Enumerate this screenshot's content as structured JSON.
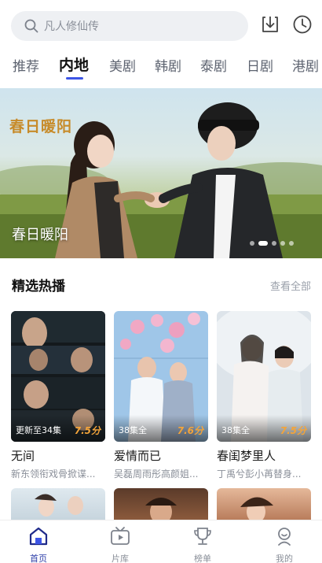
{
  "search": {
    "placeholder": "凡人修仙传"
  },
  "header_icons": {
    "download": "download-icon",
    "history": "clock-icon"
  },
  "tabs": [
    {
      "label": "推荐",
      "active": false
    },
    {
      "label": "内地",
      "active": true
    },
    {
      "label": "美剧",
      "active": false
    },
    {
      "label": "韩剧",
      "active": false
    },
    {
      "label": "泰剧",
      "active": false
    },
    {
      "label": "日剧",
      "active": false
    },
    {
      "label": "港剧",
      "active": false
    }
  ],
  "banner": {
    "logo_text": "春日暖阳",
    "caption": "春日暖阳",
    "slide_count": 5,
    "active_slide": 2
  },
  "section": {
    "title": "精选热播",
    "more": "查看全部"
  },
  "cards": [
    {
      "name": "无间",
      "desc": "新东领衔戏骨掀谍...",
      "badge": "更新至34集",
      "score": "7.5分"
    },
    {
      "name": "爱情而已",
      "desc": "吴磊周雨彤高颜姐...",
      "badge": "38集全",
      "score": "7.6分"
    },
    {
      "name": "春闺梦里人",
      "desc": "丁禹兮彭小苒替身...",
      "badge": "38集全",
      "score": "7.5分"
    }
  ],
  "bottom_nav": [
    {
      "label": "首页",
      "icon": "home-icon",
      "active": true
    },
    {
      "label": "片库",
      "icon": "tv-icon",
      "active": false
    },
    {
      "label": "榜单",
      "icon": "trophy-icon",
      "active": false
    },
    {
      "label": "我的",
      "icon": "profile-icon",
      "active": false
    }
  ],
  "colors": {
    "accent": "#3d55e6",
    "nav_active": "#2d3ea8",
    "score": "#f3a43a"
  }
}
